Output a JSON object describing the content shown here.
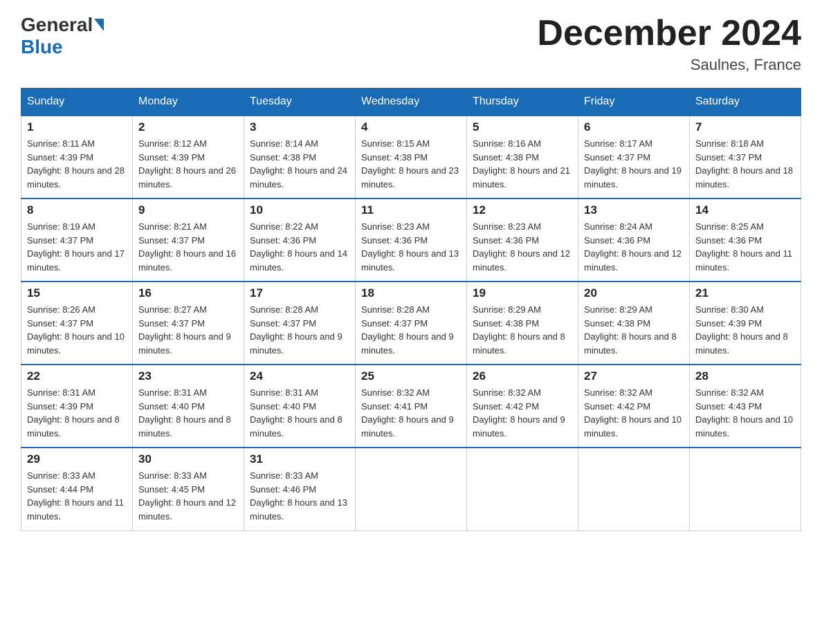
{
  "header": {
    "logo_general": "General",
    "logo_blue": "Blue",
    "month_title": "December 2024",
    "location": "Saulnes, France"
  },
  "weekdays": [
    "Sunday",
    "Monday",
    "Tuesday",
    "Wednesday",
    "Thursday",
    "Friday",
    "Saturday"
  ],
  "weeks": [
    [
      {
        "day": "1",
        "sunrise": "8:11 AM",
        "sunset": "4:39 PM",
        "daylight": "8 hours and 28 minutes."
      },
      {
        "day": "2",
        "sunrise": "8:12 AM",
        "sunset": "4:39 PM",
        "daylight": "8 hours and 26 minutes."
      },
      {
        "day": "3",
        "sunrise": "8:14 AM",
        "sunset": "4:38 PM",
        "daylight": "8 hours and 24 minutes."
      },
      {
        "day": "4",
        "sunrise": "8:15 AM",
        "sunset": "4:38 PM",
        "daylight": "8 hours and 23 minutes."
      },
      {
        "day": "5",
        "sunrise": "8:16 AM",
        "sunset": "4:38 PM",
        "daylight": "8 hours and 21 minutes."
      },
      {
        "day": "6",
        "sunrise": "8:17 AM",
        "sunset": "4:37 PM",
        "daylight": "8 hours and 19 minutes."
      },
      {
        "day": "7",
        "sunrise": "8:18 AM",
        "sunset": "4:37 PM",
        "daylight": "8 hours and 18 minutes."
      }
    ],
    [
      {
        "day": "8",
        "sunrise": "8:19 AM",
        "sunset": "4:37 PM",
        "daylight": "8 hours and 17 minutes."
      },
      {
        "day": "9",
        "sunrise": "8:21 AM",
        "sunset": "4:37 PM",
        "daylight": "8 hours and 16 minutes."
      },
      {
        "day": "10",
        "sunrise": "8:22 AM",
        "sunset": "4:36 PM",
        "daylight": "8 hours and 14 minutes."
      },
      {
        "day": "11",
        "sunrise": "8:23 AM",
        "sunset": "4:36 PM",
        "daylight": "8 hours and 13 minutes."
      },
      {
        "day": "12",
        "sunrise": "8:23 AM",
        "sunset": "4:36 PM",
        "daylight": "8 hours and 12 minutes."
      },
      {
        "day": "13",
        "sunrise": "8:24 AM",
        "sunset": "4:36 PM",
        "daylight": "8 hours and 12 minutes."
      },
      {
        "day": "14",
        "sunrise": "8:25 AM",
        "sunset": "4:36 PM",
        "daylight": "8 hours and 11 minutes."
      }
    ],
    [
      {
        "day": "15",
        "sunrise": "8:26 AM",
        "sunset": "4:37 PM",
        "daylight": "8 hours and 10 minutes."
      },
      {
        "day": "16",
        "sunrise": "8:27 AM",
        "sunset": "4:37 PM",
        "daylight": "8 hours and 9 minutes."
      },
      {
        "day": "17",
        "sunrise": "8:28 AM",
        "sunset": "4:37 PM",
        "daylight": "8 hours and 9 minutes."
      },
      {
        "day": "18",
        "sunrise": "8:28 AM",
        "sunset": "4:37 PM",
        "daylight": "8 hours and 9 minutes."
      },
      {
        "day": "19",
        "sunrise": "8:29 AM",
        "sunset": "4:38 PM",
        "daylight": "8 hours and 8 minutes."
      },
      {
        "day": "20",
        "sunrise": "8:29 AM",
        "sunset": "4:38 PM",
        "daylight": "8 hours and 8 minutes."
      },
      {
        "day": "21",
        "sunrise": "8:30 AM",
        "sunset": "4:39 PM",
        "daylight": "8 hours and 8 minutes."
      }
    ],
    [
      {
        "day": "22",
        "sunrise": "8:31 AM",
        "sunset": "4:39 PM",
        "daylight": "8 hours and 8 minutes."
      },
      {
        "day": "23",
        "sunrise": "8:31 AM",
        "sunset": "4:40 PM",
        "daylight": "8 hours and 8 minutes."
      },
      {
        "day": "24",
        "sunrise": "8:31 AM",
        "sunset": "4:40 PM",
        "daylight": "8 hours and 8 minutes."
      },
      {
        "day": "25",
        "sunrise": "8:32 AM",
        "sunset": "4:41 PM",
        "daylight": "8 hours and 9 minutes."
      },
      {
        "day": "26",
        "sunrise": "8:32 AM",
        "sunset": "4:42 PM",
        "daylight": "8 hours and 9 minutes."
      },
      {
        "day": "27",
        "sunrise": "8:32 AM",
        "sunset": "4:42 PM",
        "daylight": "8 hours and 10 minutes."
      },
      {
        "day": "28",
        "sunrise": "8:32 AM",
        "sunset": "4:43 PM",
        "daylight": "8 hours and 10 minutes."
      }
    ],
    [
      {
        "day": "29",
        "sunrise": "8:33 AM",
        "sunset": "4:44 PM",
        "daylight": "8 hours and 11 minutes."
      },
      {
        "day": "30",
        "sunrise": "8:33 AM",
        "sunset": "4:45 PM",
        "daylight": "8 hours and 12 minutes."
      },
      {
        "day": "31",
        "sunrise": "8:33 AM",
        "sunset": "4:46 PM",
        "daylight": "8 hours and 13 minutes."
      },
      null,
      null,
      null,
      null
    ]
  ]
}
